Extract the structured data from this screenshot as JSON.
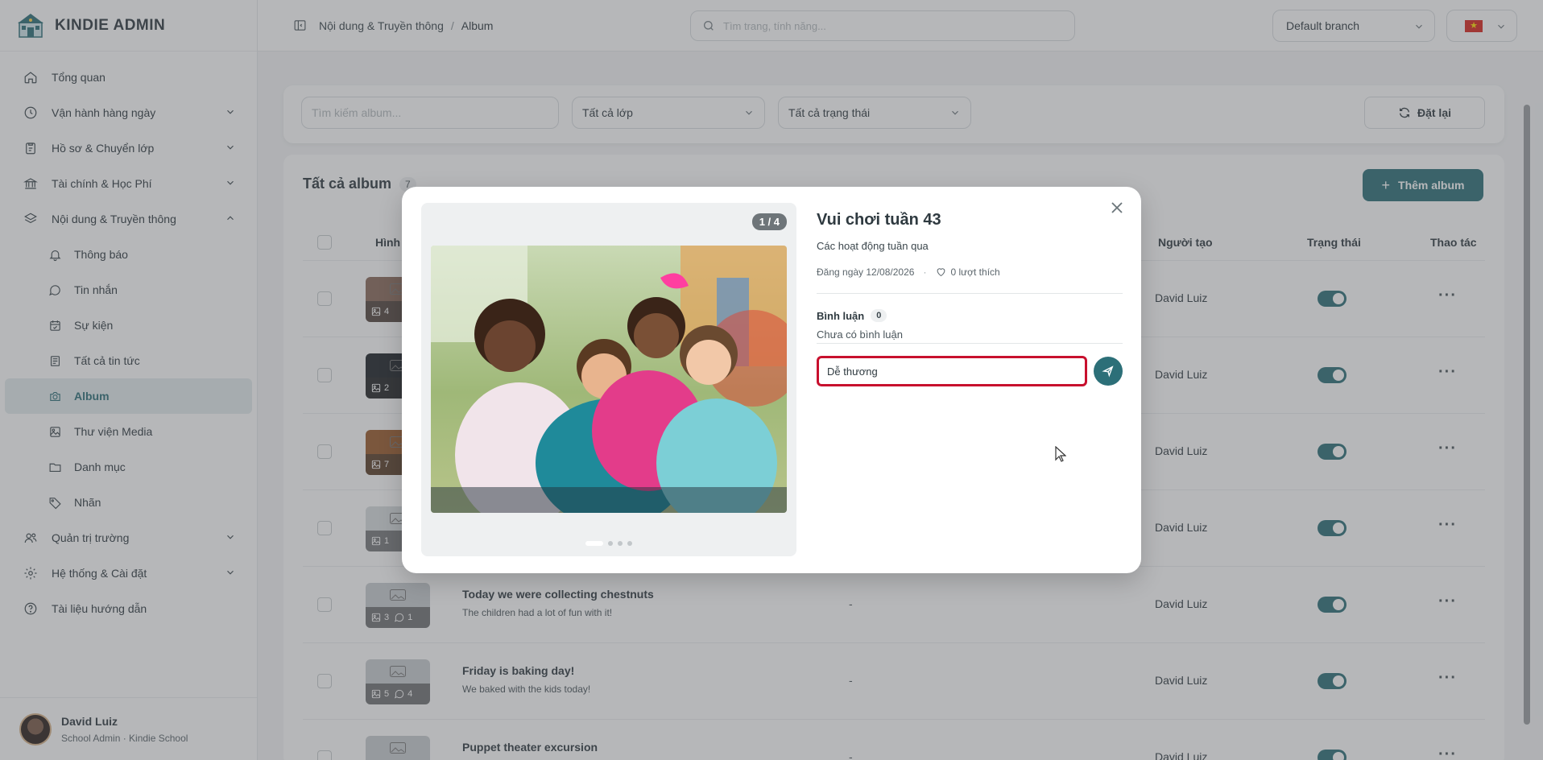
{
  "brand": {
    "name": "KINDIE ADMIN"
  },
  "sidebar": {
    "items": [
      {
        "label": "Tổng quan",
        "icon": "home-icon",
        "has_chevron": false
      },
      {
        "label": "Vận hành hàng ngày",
        "icon": "clock-icon",
        "has_chevron": true
      },
      {
        "label": "Hồ sơ & Chuyển lớp",
        "icon": "clipboard-icon",
        "has_chevron": true
      },
      {
        "label": "Tài chính & Học Phí",
        "icon": "bank-icon",
        "has_chevron": true
      },
      {
        "label": "Nội dung & Truyền thông",
        "icon": "layers-icon",
        "has_chevron": true,
        "expanded": true
      }
    ],
    "subitems": [
      {
        "label": "Thông báo",
        "icon": "bell-icon"
      },
      {
        "label": "Tin nhắn",
        "icon": "message-icon"
      },
      {
        "label": "Sự kiện",
        "icon": "calendar-icon"
      },
      {
        "label": "Tất cả tin tức",
        "icon": "newspaper-icon"
      },
      {
        "label": "Album",
        "icon": "camera-icon",
        "active": true
      },
      {
        "label": "Thư viện Media",
        "icon": "image-icon"
      },
      {
        "label": "Danh mục",
        "icon": "folder-icon"
      },
      {
        "label": "Nhãn",
        "icon": "tag-icon"
      }
    ],
    "bottom_items": [
      {
        "label": "Quản trị trường",
        "icon": "users-icon",
        "has_chevron": true
      },
      {
        "label": "Hệ thống & Cài đặt",
        "icon": "gear-icon",
        "has_chevron": true
      },
      {
        "label": "Tài liệu hướng dẫn",
        "icon": "help-icon",
        "has_chevron": false
      }
    ],
    "user": {
      "name": "David Luiz",
      "role": "School Admin · Kindie School"
    }
  },
  "header": {
    "breadcrumb": [
      "Nội dung & Truyền thông",
      "Album"
    ],
    "search_placeholder": "Tìm trang, tính năng...",
    "branch": "Default branch",
    "flag": "★"
  },
  "filters": {
    "search_placeholder": "Tìm kiếm album...",
    "class_select": "Tất cả lớp",
    "status_select": "Tất cả trạng thái",
    "reset_label": "Đặt lại"
  },
  "album_list": {
    "title": "Tất cả album",
    "count": "7",
    "add_label": "Thêm album",
    "columns": {
      "image": "Hình ảnh",
      "creator": "Người tạo",
      "status": "Trạng thái",
      "actions": "Thao tác"
    },
    "rows": [
      {
        "photos": "4",
        "comments": "",
        "title": "",
        "desc": "",
        "class": "-",
        "author": "David Luiz",
        "active": true
      },
      {
        "photos": "2",
        "comments": "",
        "title": "",
        "desc": "",
        "class": "-",
        "author": "David Luiz",
        "active": true
      },
      {
        "photos": "7",
        "comments": "",
        "title": "",
        "desc": "",
        "class": "-",
        "author": "David Luiz",
        "active": true
      },
      {
        "photos": "1",
        "comments": "",
        "title": "",
        "desc": "",
        "class": "-",
        "author": "David Luiz",
        "active": true
      },
      {
        "photos": "3",
        "comments": "1",
        "title": "Today we were collecting chestnuts",
        "desc": "The children had a lot of fun with it!",
        "class": "-",
        "author": "David Luiz",
        "active": true
      },
      {
        "photos": "5",
        "comments": "4",
        "title": "Friday is baking day!",
        "desc": "We baked with the kids today!",
        "class": "-",
        "author": "David Luiz",
        "active": true
      },
      {
        "photos": "",
        "comments": "",
        "title": "Puppet theater excursion",
        "desc": "",
        "class": "-",
        "author": "David Luiz",
        "active": true
      }
    ]
  },
  "modal": {
    "counter": "1 / 4",
    "title": "Vui chơi tuần 43",
    "subtitle": "Các hoạt động tuần qua",
    "posted": "Đăng ngày 12/08/2026",
    "likes": "0 lượt thích",
    "comments_label": "Bình luận",
    "comments_count": "0",
    "no_comments": "Chưa có bình luận",
    "comment_value": "Dễ thương",
    "dots_total": 4,
    "dots_active": 1
  },
  "colors": {
    "accent": "#2c6f78",
    "focus_border": "#c8102e"
  }
}
